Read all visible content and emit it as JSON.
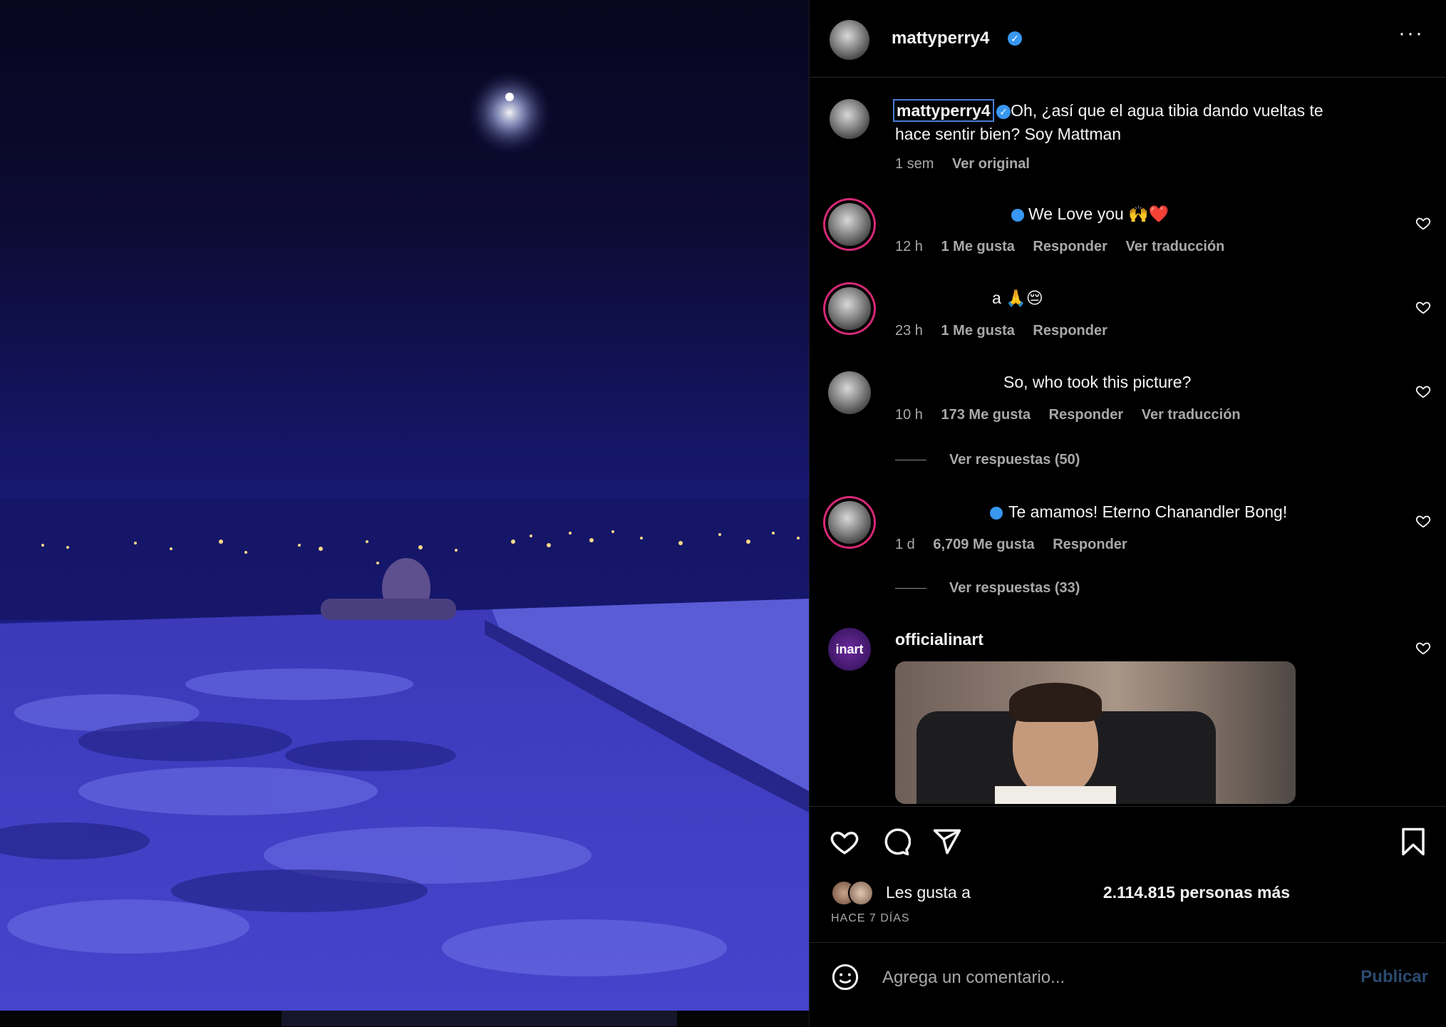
{
  "post": {
    "author": "mattyperry4",
    "more_icon": "more-horizontal-icon",
    "image_description_icon": "post-photo"
  },
  "caption": {
    "user": "mattyperry4",
    "line1": "Oh, ¿así que el agua tibia dando vueltas te",
    "line2": "hace sentir bien? Soy Mattman",
    "time": "1 sem",
    "see_original": "Ver original"
  },
  "comments": [
    {
      "text": "We Love you 🙌❤️",
      "time": "12 h",
      "likes": "1 Me gusta",
      "reply": "Responder",
      "translate": "Ver traducción"
    },
    {
      "text": "a 🙏😔",
      "time": "23 h",
      "likes": "1 Me gusta",
      "reply": "Responder"
    },
    {
      "text": "So, who took this picture?",
      "time": "10 h",
      "likes": "173 Me gusta",
      "reply": "Responder",
      "translate": "Ver traducción",
      "replies": "Ver respuestas (50)"
    },
    {
      "text": "Te amamos! Eterno Chanandler Bong!",
      "time": "1 d",
      "likes": "6,709 Me gusta",
      "reply": "Responder",
      "replies": "Ver respuestas (33)"
    },
    {
      "user": "officialinart",
      "avatar_text": "inart"
    }
  ],
  "actions": {
    "likes_prefix": "Les gusta a",
    "likes_count": "2.114.815 personas más",
    "time_ago": "HACE 7 DÍAS"
  },
  "composer": {
    "placeholder": "Agrega un comentario...",
    "publish": "Publicar"
  },
  "colors": {
    "verified": "#3897f0",
    "photo_blue": "#3d3bc4",
    "ring": "#d62976"
  }
}
